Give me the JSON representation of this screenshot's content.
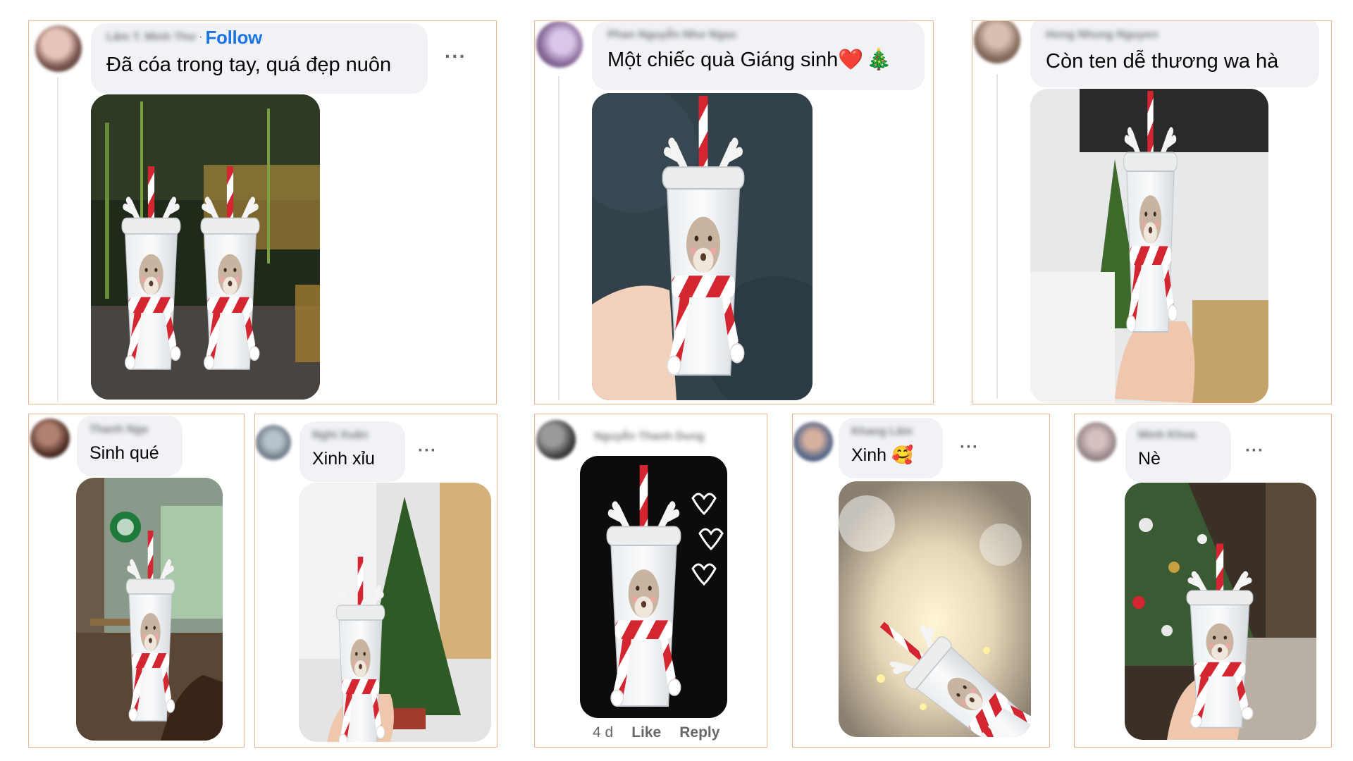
{
  "comments": [
    {
      "id": "c1",
      "author": "Lâm T. Minh Thư",
      "separator": "·",
      "follow_label": "Follow",
      "text": "Đã cóa trong tay, quá đẹp nuôn",
      "more_label": "···",
      "photo_icon": "reindeer-tumbler-pair-photo"
    },
    {
      "id": "c2",
      "author": "Phan Nguyễn Như Ngọc",
      "text": "Một chiếc quà Giáng sinh",
      "emoji": [
        "❤️",
        "🎄"
      ],
      "photo_icon": "reindeer-tumbler-hand-photo"
    },
    {
      "id": "c3",
      "author": "Hong Nhung Nguyen",
      "text": "Còn ten dễ thương wa hà",
      "photo_icon": "reindeer-tumbler-office-photo"
    },
    {
      "id": "c4",
      "author": "Thanh Nga",
      "text": "Sinh qué",
      "photo_icon": "reindeer-tumbler-cafe-photo"
    },
    {
      "id": "c5",
      "author": "Nghi Xuân",
      "text": "Xinh xỉu",
      "more_label": "···",
      "photo_icon": "reindeer-tumbler-tree-photo"
    },
    {
      "id": "c6",
      "author": "Nguyễn Thanh Dung",
      "timestamp": "4 d",
      "like_label": "Like",
      "reply_label": "Reply",
      "photo_icon": "reindeer-tumbler-dark-hearts-photo"
    },
    {
      "id": "c7",
      "author": "Khang Lâm",
      "text": "Xinh",
      "emoji": [
        "🥰"
      ],
      "more_label": "···",
      "photo_icon": "reindeer-tumbler-lights-photo"
    },
    {
      "id": "c8",
      "author": "Minh Khoa",
      "text": "Nè",
      "more_label": "···",
      "photo_icon": "reindeer-tumbler-xmas-tree-photo"
    }
  ],
  "colors": {
    "card_border": "#f3b58f",
    "bubble_bg": "#f0f2f5",
    "link_blue": "#1b74e4",
    "muted": "#65676b",
    "scarf_red": "#d32630"
  }
}
